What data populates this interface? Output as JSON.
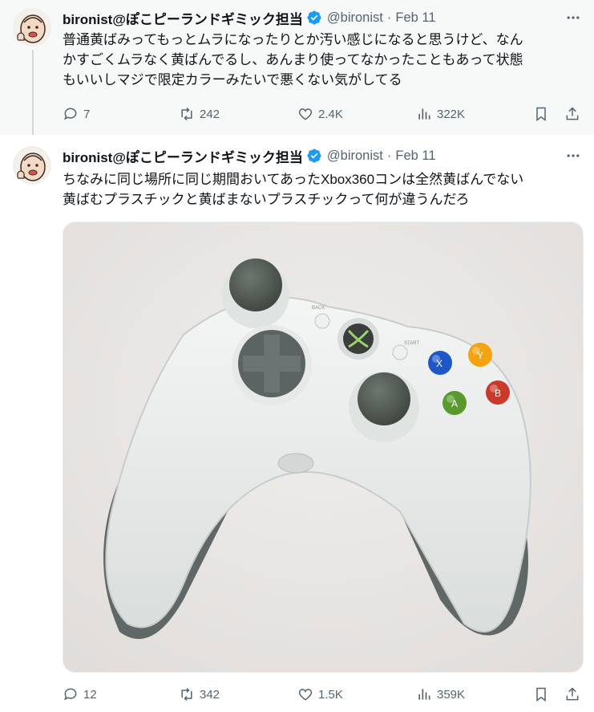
{
  "tweets": [
    {
      "author": {
        "name": "bironist@ぽこピーランドギミック担当",
        "handle": "@bironist",
        "date": "Feb 11"
      },
      "text": "普通黄ばみってもっとムラになったりとか汚い感じになると思うけど、なん\nかすごくムラなく黄ばんでるし、あんまり使ってなかったこともあって状態\nもいいしマジで限定カラーみたいで悪くない気がしてる",
      "stats": {
        "replies": "7",
        "reposts": "242",
        "likes": "2.4K",
        "views": "322K"
      }
    },
    {
      "author": {
        "name": "bironist@ぽこピーランドギミック担当",
        "handle": "@bironist",
        "date": "Feb 11"
      },
      "text": "ちなみに同じ場所に同じ期間おいてあったXbox360コンは全然黄ばんでない\n黄ばむプラスチックと黄ばまないプラスチックって何が違うんだろ",
      "media": {
        "buttons": [
          "BACK",
          "START",
          "X",
          "Y",
          "A",
          "B"
        ]
      },
      "stats": {
        "replies": "12",
        "reposts": "342",
        "likes": "1.5K",
        "views": "359K"
      }
    }
  ],
  "ui": {
    "separator": "·",
    "more": "•••"
  },
  "colors": {
    "verified": "#1d9bf0",
    "muted": "#536471",
    "text": "#0f1419",
    "highlight_bg": "#f7f9f9"
  }
}
